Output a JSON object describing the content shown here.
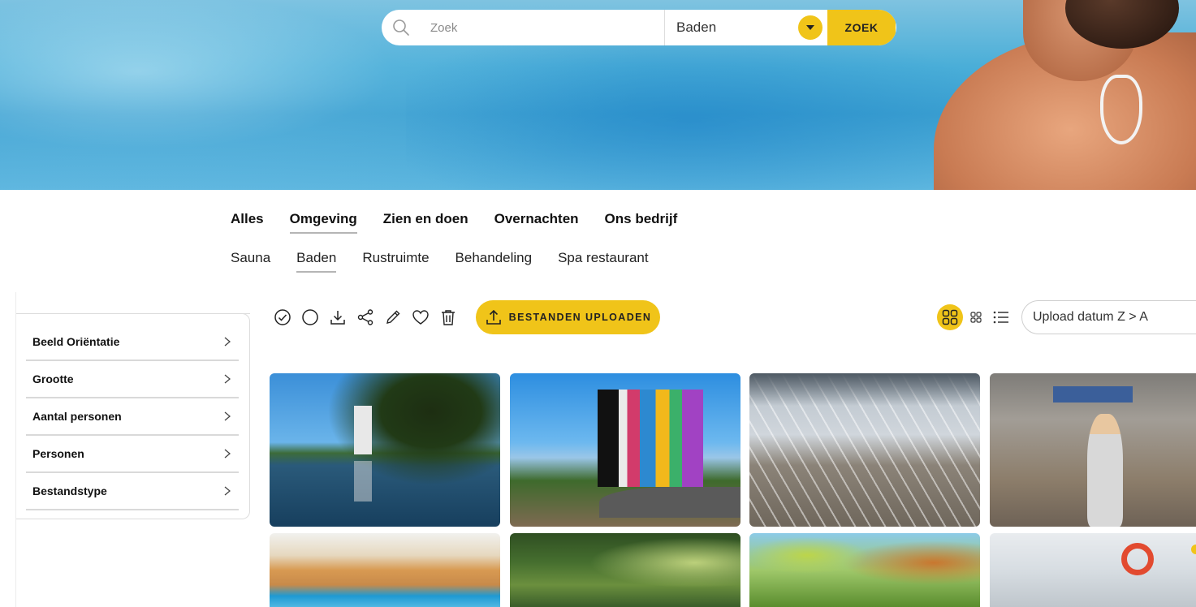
{
  "search": {
    "placeholder": "Zoek",
    "category_value": "Baden",
    "button_label": "ZOEK"
  },
  "nav": {
    "tabs": [
      {
        "label": "Alles",
        "active": false
      },
      {
        "label": "Omgeving",
        "active": true
      },
      {
        "label": "Zien en doen",
        "active": false
      },
      {
        "label": "Overnachten",
        "active": false
      },
      {
        "label": "Ons bedrijf",
        "active": false
      }
    ],
    "subtabs": [
      {
        "label": "Sauna",
        "active": false
      },
      {
        "label": "Baden",
        "active": true
      },
      {
        "label": "Rustruimte",
        "active": false
      },
      {
        "label": "Behandeling",
        "active": false
      },
      {
        "label": "Spa restaurant",
        "active": false
      }
    ]
  },
  "filters": [
    {
      "label": "Beeld Oriëntatie"
    },
    {
      "label": "Grootte"
    },
    {
      "label": "Aantal personen"
    },
    {
      "label": "Personen"
    },
    {
      "label": "Bestandstype"
    }
  ],
  "toolbar": {
    "icons": [
      "check-circle-icon",
      "circle-icon",
      "download-icon",
      "share-icon",
      "pencil-icon",
      "heart-icon",
      "trash-icon"
    ],
    "upload_label": "BESTANDEN UPLOADEN",
    "sort_value": "Upload datum Z > A"
  },
  "colors": {
    "accent": "#f0c419",
    "text": "#111111",
    "border": "#dcdcdc"
  }
}
